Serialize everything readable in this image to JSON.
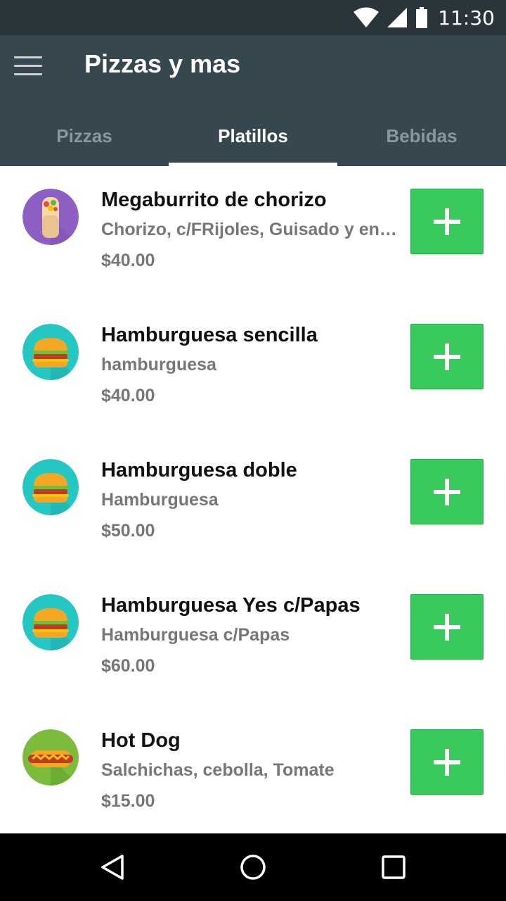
{
  "status_bar": {
    "time": "11:30",
    "icons": [
      "wifi-icon",
      "signal-icon",
      "battery-icon"
    ]
  },
  "app_bar": {
    "title": "Pizzas y mas",
    "menu_icon": "menu-icon"
  },
  "tabs": [
    {
      "label": "Pizzas",
      "active": false
    },
    {
      "label": "Platillos",
      "active": true
    },
    {
      "label": "Bebidas",
      "active": false
    }
  ],
  "items": [
    {
      "name": "Megaburrito de chorizo",
      "description": "Chorizo, c/FRijoles, Guisado y en…",
      "price": "$40.00",
      "icon": "burrito-icon",
      "icon_bg": "#8e5fc2"
    },
    {
      "name": "Hamburguesa sencilla",
      "description": "hamburguesa",
      "price": "$40.00",
      "icon": "burger-icon",
      "icon_bg": "#26c6c2"
    },
    {
      "name": "Hamburguesa doble",
      "description": "Hamburguesa",
      "price": "$50.00",
      "icon": "burger-icon",
      "icon_bg": "#26c6c2"
    },
    {
      "name": "Hamburguesa Yes c/Papas",
      "description": "Hamburguesa c/Papas",
      "price": "$60.00",
      "icon": "burger-icon",
      "icon_bg": "#26c6c2"
    },
    {
      "name": "Hot Dog",
      "description": "Salchichas, cebolla, Tomate",
      "price": "$15.00",
      "icon": "hotdog-icon",
      "icon_bg": "#7cbb3c"
    }
  ],
  "add_button_icon": "plus-icon",
  "colors": {
    "status_bar": "#2a343b",
    "app_bar": "#37474f",
    "add_button": "#3ac95d"
  },
  "nav_bar": {
    "icons": [
      "back-icon",
      "home-icon",
      "recents-icon"
    ]
  }
}
